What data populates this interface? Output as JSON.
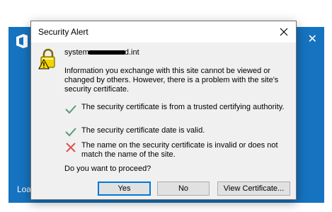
{
  "background": {
    "loading_text": "Loa",
    "close_glyph": "✕",
    "accent": "#1673bf"
  },
  "dialog": {
    "title": "Security Alert",
    "close_glyph": "✕",
    "icon": "padlock-warning-icon",
    "host_prefix": "system",
    "host_suffix": "d.int",
    "message": "Information you exchange with this site cannot be viewed or changed by others. However, there is a problem with the site's security certificate.",
    "checks": [
      {
        "status": "ok",
        "icon": "checkmark-icon",
        "text": "The security certificate is from a trusted certifying authority."
      },
      {
        "status": "ok",
        "icon": "checkmark-icon",
        "text": "The security certificate date is valid."
      },
      {
        "status": "error",
        "icon": "x-mark-icon",
        "text": "The name on the security certificate is invalid or does not match the name of the site."
      }
    ],
    "question": "Do you want to proceed?",
    "buttons": {
      "yes": "Yes",
      "no": "No",
      "view_certificate": "View Certificate..."
    }
  }
}
